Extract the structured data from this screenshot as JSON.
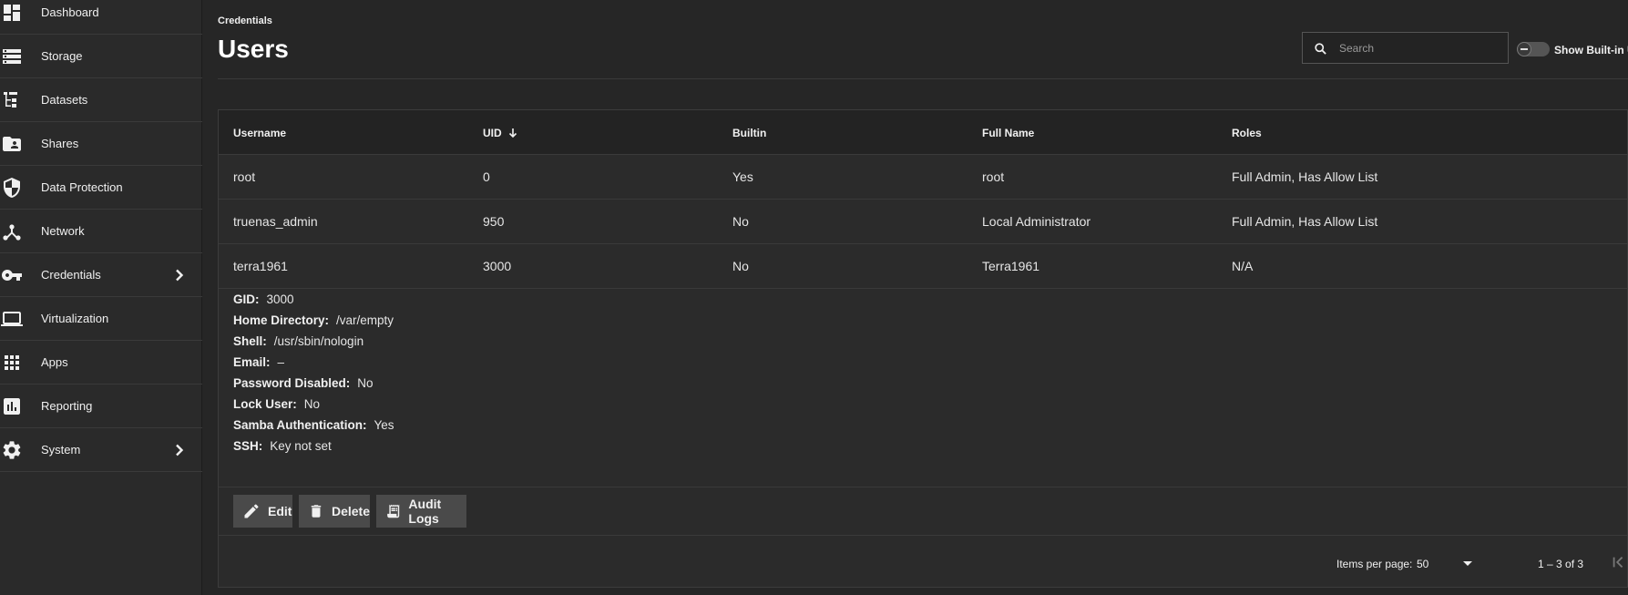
{
  "sidebar": {
    "items": [
      {
        "label": "Dashboard",
        "icon": "dashboard-icon"
      },
      {
        "label": "Storage",
        "icon": "storage-icon"
      },
      {
        "label": "Datasets",
        "icon": "datasets-icon"
      },
      {
        "label": "Shares",
        "icon": "shares-icon"
      },
      {
        "label": "Data Protection",
        "icon": "shield-icon"
      },
      {
        "label": "Network",
        "icon": "network-icon"
      },
      {
        "label": "Credentials",
        "icon": "key-icon"
      },
      {
        "label": "Virtualization",
        "icon": "laptop-icon"
      },
      {
        "label": "Apps",
        "icon": "apps-grid-icon"
      },
      {
        "label": "Reporting",
        "icon": "chart-icon"
      },
      {
        "label": "System",
        "icon": "gear-icon"
      }
    ]
  },
  "header": {
    "breadcrumb": "Credentials",
    "title": "Users",
    "search_placeholder": "Search",
    "toggle_label": "Show Built-in Users"
  },
  "table": {
    "columns": [
      "Username",
      "UID",
      "Builtin",
      "Full Name",
      "Roles"
    ],
    "rows": [
      {
        "username": "root",
        "uid": "0",
        "builtin": "Yes",
        "full_name": "root",
        "roles": "Full Admin, Has Allow List"
      },
      {
        "username": "truenas_admin",
        "uid": "950",
        "builtin": "No",
        "full_name": "Local Administrator",
        "roles": "Full Admin, Has Allow List"
      },
      {
        "username": "terra1961",
        "uid": "3000",
        "builtin": "No",
        "full_name": "Terra1961",
        "roles": "N/A"
      }
    ]
  },
  "details": [
    {
      "key": "GID:",
      "value": "3000"
    },
    {
      "key": "Home Directory:",
      "value": "/var/empty"
    },
    {
      "key": "Shell:",
      "value": "/usr/sbin/nologin"
    },
    {
      "key": "Email:",
      "value": "–"
    },
    {
      "key": "Password Disabled:",
      "value": "No"
    },
    {
      "key": "Lock User:",
      "value": "No"
    },
    {
      "key": "Samba Authentication:",
      "value": "Yes"
    },
    {
      "key": "SSH:",
      "value": "Key not set"
    }
  ],
  "actions": {
    "edit": "Edit",
    "delete": "Delete",
    "audit_logs": "Audit Logs"
  },
  "pager": {
    "items_per_page_label": "Items per page:",
    "items_per_page": "50",
    "range": "1 – 3 of 3"
  }
}
